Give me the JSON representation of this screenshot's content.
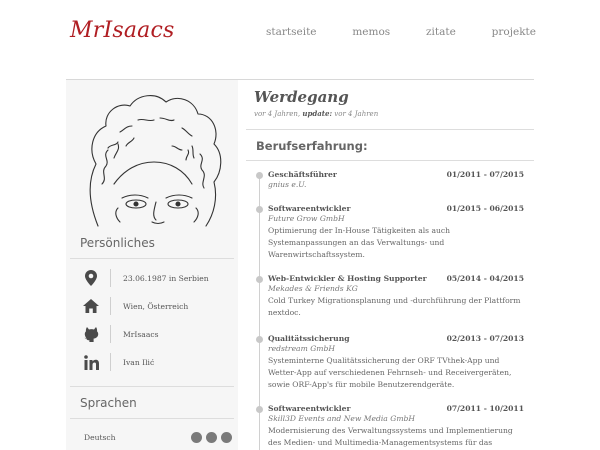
{
  "site": {
    "logo": "MrIsaacs"
  },
  "nav": [
    {
      "label": "startseite"
    },
    {
      "label": "memos"
    },
    {
      "label": "zitate"
    },
    {
      "label": "projekte"
    }
  ],
  "sidebar": {
    "personal_heading": "Persönliches",
    "info": [
      {
        "icon": "location-pin-icon",
        "text": "23.06.1987 in Serbien"
      },
      {
        "icon": "home-icon",
        "text": "Wien, Österreich"
      },
      {
        "icon": "github-icon",
        "text": "MrIsaacs"
      },
      {
        "icon": "linkedin-icon",
        "text": "Ivan Ilić"
      }
    ],
    "languages_heading": "Sprachen",
    "languages": [
      {
        "name": "Deutsch",
        "level": 3,
        "max": 3
      }
    ]
  },
  "main": {
    "title": "Werdegang",
    "meta_prefix": "vor 4 Jahren,",
    "meta_update_label": "update:",
    "meta_update_value": "vor 4 Jahren",
    "section_heading": "Berufserfahrung:",
    "entries": [
      {
        "role": "Geschäftsführer",
        "date": "01/2011 - 07/2015",
        "company": "gnius e.U.",
        "desc": ""
      },
      {
        "role": "Softwareentwickler",
        "date": "01/2015 - 06/2015",
        "company": "Future Grow GmbH",
        "desc": "Optimierung der In-House Tätigkeiten als auch Systemanpassungen an das Verwaltungs- und Warenwirtschaftssystem."
      },
      {
        "role": "Web-Entwickler & Hosting Supporter",
        "date": "05/2014 - 04/2015",
        "company": "Mekades & Friends KG",
        "desc": "Cold Turkey Migrationsplanung und -durchführung der Plattform nextdoc."
      },
      {
        "role": "Qualitätssicherung",
        "date": "02/2013 - 07/2013",
        "company": "redstream GmbH",
        "desc": "Systeminterne Qualitätssicherung der ORF TVthek-App und Wetter-App auf verschiedenen Fehrnseh- und Receivergeräten, sowie ORF-App's für mobile Benutzerendgeräte."
      },
      {
        "role": "Softwareentwickler",
        "date": "07/2011 - 10/2011",
        "company": "Skill3D Events and New Media GmbH",
        "desc": "Modernisierung des Verwaltungssystems und Implementierung des Medien- und Multimedia-Managementsystems für das"
      }
    ]
  },
  "colors": {
    "accent": "#b01e23",
    "sidebar_bg": "#f6f6f6",
    "text": "#555555"
  }
}
